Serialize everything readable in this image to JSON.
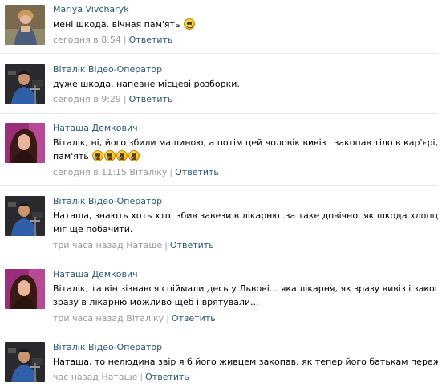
{
  "comments": [
    {
      "author": "Mariya Vivcharyk",
      "text": "мені шкода. вічная пам'ять",
      "time": "сегодня в 8:54",
      "reply_to": "",
      "reply_label": "Ответить",
      "emoji": [
        "grin"
      ]
    },
    {
      "author": "Віталік Відео-Оператор",
      "text": "дуже шкода. напевне місцеві розборки.",
      "time": "сегодня в 9:29",
      "reply_to": "",
      "reply_label": "Ответить",
      "emoji": []
    },
    {
      "author": "Наташа Демкович",
      "text_line1": "Віталік, ні, його збили машиною, а потім цей чоловік вивіз і закопав тіло в кар'єрі, Вічна",
      "text_line2": "пам'ять",
      "time": "сегодня в 11:15",
      "reply_to": "Віталіку",
      "reply_label": "Ответить",
      "emoji": [
        "cry",
        "cry",
        "cry",
        "cry"
      ]
    },
    {
      "author": "Віталік Відео-Оператор",
      "text_line1": "Наташа, знають хоть хто. збив завези в лікарню .за таке довічно. як шкода хлопця. скільки",
      "text_line2": "міг ще побачити.",
      "time": "три часа назад",
      "reply_to": "Наташе",
      "reply_label": "Ответить",
      "emoji": []
    },
    {
      "author": "Наташа Демкович",
      "text_line1": "Віталік, та він зізнався спіймали десь у Львові... яка лікарня, як зразу вивіз і закопав, якщоб",
      "text_line2": "зразу в лікарню можливо щеб і врятували...",
      "time": "три часа назад",
      "reply_to": "Віталіку",
      "reply_label": "Ответить",
      "emoji": []
    },
    {
      "author": "Віталік Відео-Оператор",
      "text": "Наташа, то нелюдина звір я б його живцем закопав. як тепер його батькам пережити.",
      "time": "час назад",
      "reply_to": "Наташе",
      "reply_label": "Ответить",
      "emoji": []
    }
  ],
  "colors": {
    "link": "#2b587a",
    "meta": "#999999",
    "divider": "#e7e7e7"
  }
}
